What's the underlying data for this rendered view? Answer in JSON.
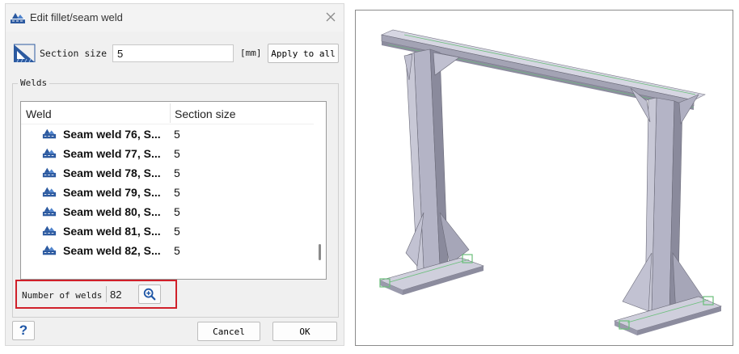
{
  "dialog": {
    "title": "Edit fillet/seam weld",
    "section_size_label": "Section size",
    "section_size_value": "5",
    "unit": "[mm]",
    "apply_to_all": "Apply to all",
    "group_title": "Welds",
    "columns": {
      "weld": "Weld",
      "section_size": "Section size"
    },
    "rows": [
      {
        "name": "Seam weld 76, S...",
        "size": "5"
      },
      {
        "name": "Seam weld 77, S...",
        "size": "5"
      },
      {
        "name": "Seam weld 78, S...",
        "size": "5"
      },
      {
        "name": "Seam weld 79, S...",
        "size": "5"
      },
      {
        "name": "Seam weld 80, S...",
        "size": "5"
      },
      {
        "name": "Seam weld 81, S...",
        "size": "5"
      },
      {
        "name": "Seam weld 82, S...",
        "size": "5"
      }
    ],
    "number_of_welds_label": "Number of welds",
    "number_of_welds_value": "82",
    "help": "?",
    "cancel": "Cancel",
    "ok": "OK"
  },
  "icons": {
    "title": "weld-icon",
    "close": "close-icon",
    "section": "weld-section-icon",
    "row": "weld-icon",
    "zoom": "zoom-in-icon"
  },
  "colors": {
    "highlight_border": "#d0202a",
    "icon_blue": "#2c5aa0",
    "steel": "#b4b4c6",
    "weld_green": "#6abf7a"
  }
}
